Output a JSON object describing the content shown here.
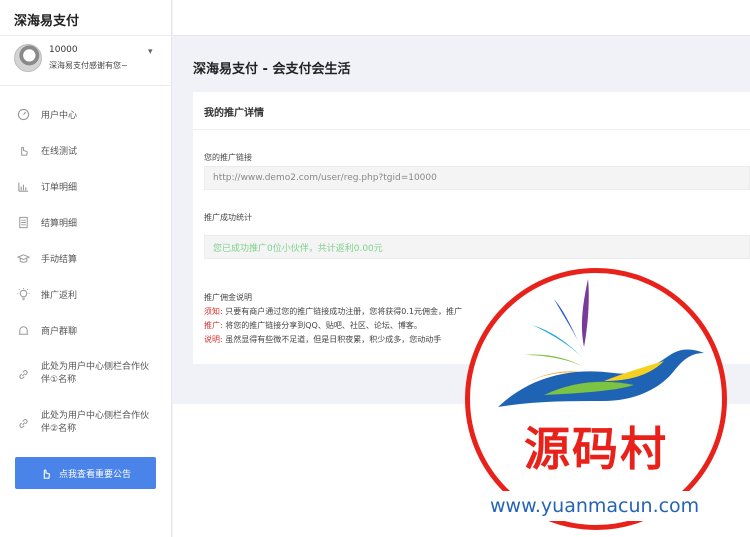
{
  "sidebar": {
    "brand": "深海易支付",
    "user": {
      "id": "10000",
      "desc": "深海易支付感谢有您~"
    },
    "items": [
      {
        "label": "用户中心",
        "icon": "dashboard-icon"
      },
      {
        "label": "在线测试",
        "icon": "hand-pointer-icon"
      },
      {
        "label": "订单明细",
        "icon": "bar-chart-icon"
      },
      {
        "label": "结算明细",
        "icon": "document-icon"
      },
      {
        "label": "手动结算",
        "icon": "graduation-cap-icon"
      },
      {
        "label": "推广返利",
        "icon": "lightbulb-icon"
      },
      {
        "label": "商户群聊",
        "icon": "bell-icon"
      },
      {
        "label": "此处为用户中心侧栏合作伙伴①名称",
        "icon": "link-icon"
      },
      {
        "label": "此处为用户中心侧栏合作伙伴②名称",
        "icon": "link-icon"
      }
    ],
    "notice_button": "点我查看重要公告"
  },
  "main": {
    "page_title": "深海易支付 - 会支付会生活",
    "card_title": "我的推广详情",
    "link_label": "您的推广链接",
    "link_value": "http://www.demo2.com/user/reg.php?tgid=10000",
    "stat_label": "推广成功统计",
    "stat_value": "您已成功推广0位小伙伴，共计返利0.00元",
    "desc_title": "推广佣金说明",
    "desc": [
      {
        "key": "须知:",
        "text": " 只要有商户通过您的推广链接成功注册，您将获得0.1元佣金，推广"
      },
      {
        "key": "推广:",
        "text": " 将您的推广链接分享到QQ、贴吧、社区、论坛、博客。"
      },
      {
        "key": "说明:",
        "text": " 虽然显得有些微不足道，但是日积夜累，积少成多，您动动手"
      }
    ]
  },
  "watermark": {
    "name": "源码村",
    "url": "www.yuanmacun.com",
    "colors": {
      "ring": "#e8221b",
      "url": "#2563b6"
    }
  },
  "colors": {
    "accent": "#4a84e8",
    "stat_text": "#7fcf8e",
    "desc_key": "#d9302c"
  }
}
